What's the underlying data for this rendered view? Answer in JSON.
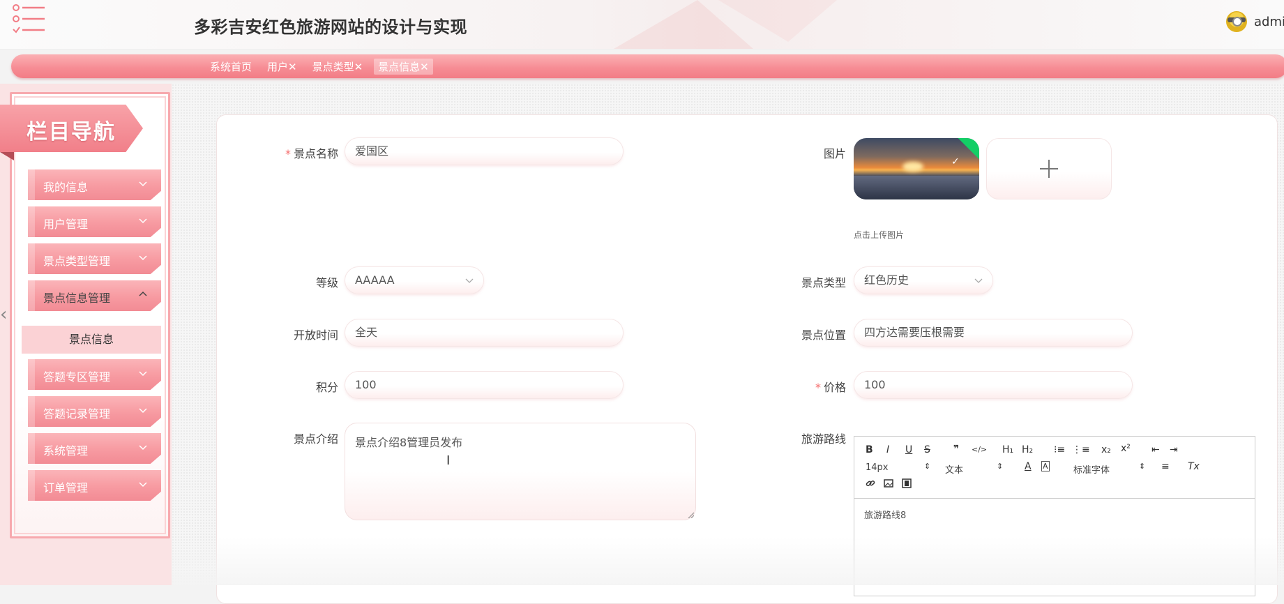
{
  "header": {
    "title": "多彩吉安红色旅游网站的设计与实现",
    "username": "admin"
  },
  "tabs": [
    {
      "label": "系统首页"
    },
    {
      "label": "用户✕"
    },
    {
      "label": "景点类型✕"
    },
    {
      "label": "景点信息✕"
    }
  ],
  "sidebar": {
    "title": "栏目导航",
    "items": [
      {
        "label": "我的信息"
      },
      {
        "label": "用户管理"
      },
      {
        "label": "景点类型管理"
      },
      {
        "label": "景点信息管理"
      },
      {
        "label": "答题专区管理"
      },
      {
        "label": "答题记录管理"
      },
      {
        "label": "系统管理"
      },
      {
        "label": "订单管理"
      }
    ],
    "sub_item": "景点信息"
  },
  "form": {
    "name_label": "景点名称",
    "name_value": "爱国区",
    "image_label": "图片",
    "upload_hint": "点击上传图片",
    "level_label": "等级",
    "level_value": "AAAAA",
    "type_label": "景点类型",
    "type_value": "红色历史",
    "open_label": "开放时间",
    "open_value": "全天",
    "location_label": "景点位置",
    "location_value": "四方达需要压根需要",
    "points_label": "积分",
    "points_value": "100",
    "price_label": "价格",
    "price_value": "100",
    "intro_label": "景点介绍",
    "intro_value": "景点介绍8管理员发布",
    "route_label": "旅游路线",
    "required_mark": "*"
  },
  "editor": {
    "font_size": "14px",
    "text_type": "文本",
    "font_family": "标准字体",
    "content": "旅游路线8",
    "buttons": {
      "bold": "B",
      "italic": "I",
      "underline": "U",
      "strike": "S",
      "quote": "❞",
      "code": "</>",
      "h1": "H₁",
      "h2": "H₂",
      "ol": "⁝≡",
      "ul": "⋮≡",
      "sub": "x₂",
      "sup": "x²",
      "outdent": "⇤",
      "indent": "⇥",
      "color": "A",
      "background": "A",
      "align": "≡",
      "clean": "Tx",
      "link": "🔗",
      "image": "▣",
      "video": "▤"
    }
  },
  "colors": {
    "accent": "#f27d86",
    "accent_light": "#fbb0b4",
    "required": "#f56c6c",
    "success_badge": "#13ce66"
  }
}
